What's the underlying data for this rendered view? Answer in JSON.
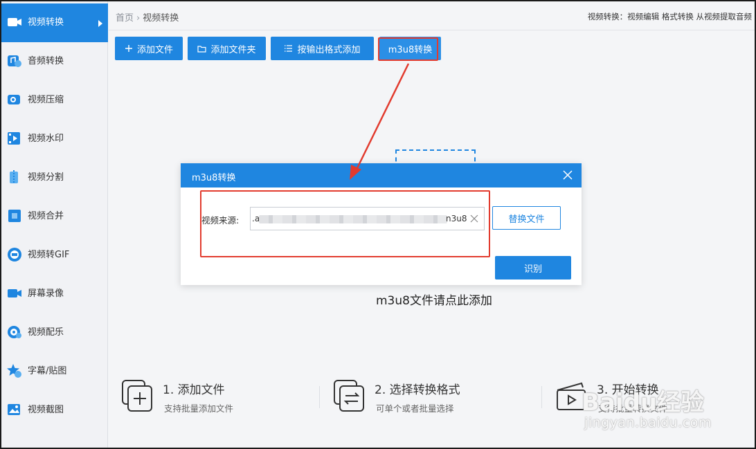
{
  "sidebar": {
    "items": [
      {
        "label": "视频转换",
        "icon": "video-convert-icon"
      },
      {
        "label": "音频转换",
        "icon": "audio-convert-icon"
      },
      {
        "label": "视频压缩",
        "icon": "video-compress-icon"
      },
      {
        "label": "视频水印",
        "icon": "video-watermark-icon"
      },
      {
        "label": "视频分割",
        "icon": "video-split-icon"
      },
      {
        "label": "视频合并",
        "icon": "video-merge-icon"
      },
      {
        "label": "视频转GIF",
        "icon": "gif-icon"
      },
      {
        "label": "屏幕录像",
        "icon": "screen-record-icon"
      },
      {
        "label": "视频配乐",
        "icon": "music-icon"
      },
      {
        "label": "字幕/贴图",
        "icon": "subtitle-icon"
      },
      {
        "label": "视频截图",
        "icon": "screenshot-icon"
      }
    ]
  },
  "header": {
    "breadcrumb_home": "首页",
    "breadcrumb_sep": "›",
    "breadcrumb_current": "视频转换",
    "promo": "视频转换：视频编辑 格式转换 从视频提取音频"
  },
  "toolbar": {
    "add_file": "添加文件",
    "add_folder": "添加文件夹",
    "add_by_format": "按输出格式添加",
    "m3u8": "m3u8转换"
  },
  "main": {
    "drop_hint": "m3u8文件请点此添加"
  },
  "steps": [
    {
      "title": "1. 添加文件",
      "desc": "支持批量添加文件"
    },
    {
      "title": "2. 选择转换格式",
      "desc": "可单个或者批量选择"
    },
    {
      "title": "3. 开始转换",
      "desc": "支持批量转换文件"
    }
  ],
  "dialog": {
    "title": "m3u8转换",
    "source_label": "视频来源:",
    "source_prefix": ".a",
    "source_suffix": "n3u8",
    "replace_button": "替换文件",
    "recognize_button": "识别"
  },
  "watermark": {
    "logo": "Baidu经验",
    "url": "jingyan.baidu.com"
  },
  "colors": {
    "accent": "#1f86e0",
    "annotation": "#e23b2e"
  }
}
